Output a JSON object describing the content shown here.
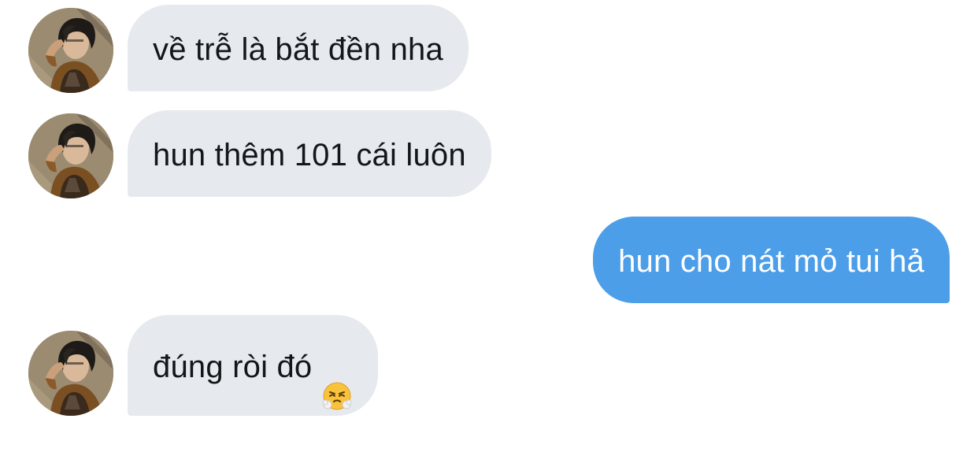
{
  "conversation": {
    "messages": [
      {
        "sender": "other",
        "text": "về trễ là bắt đền nha",
        "avatar_icon": "profile-photo"
      },
      {
        "sender": "other",
        "text": "hun thêm 101 cái luôn",
        "avatar_icon": "profile-photo"
      },
      {
        "sender": "me",
        "text": "hun cho nát mỏ tui hả"
      },
      {
        "sender": "other",
        "text": "đúng ròi đó",
        "emoji_icon": "face-with-steam-from-nose-emoji",
        "avatar_icon": "profile-photo"
      }
    ]
  },
  "colors": {
    "incoming_bubble": "#e6e9ee",
    "outgoing_bubble": "#4c9ee9",
    "incoming_text": "#14171a",
    "outgoing_text": "#ffffff"
  }
}
